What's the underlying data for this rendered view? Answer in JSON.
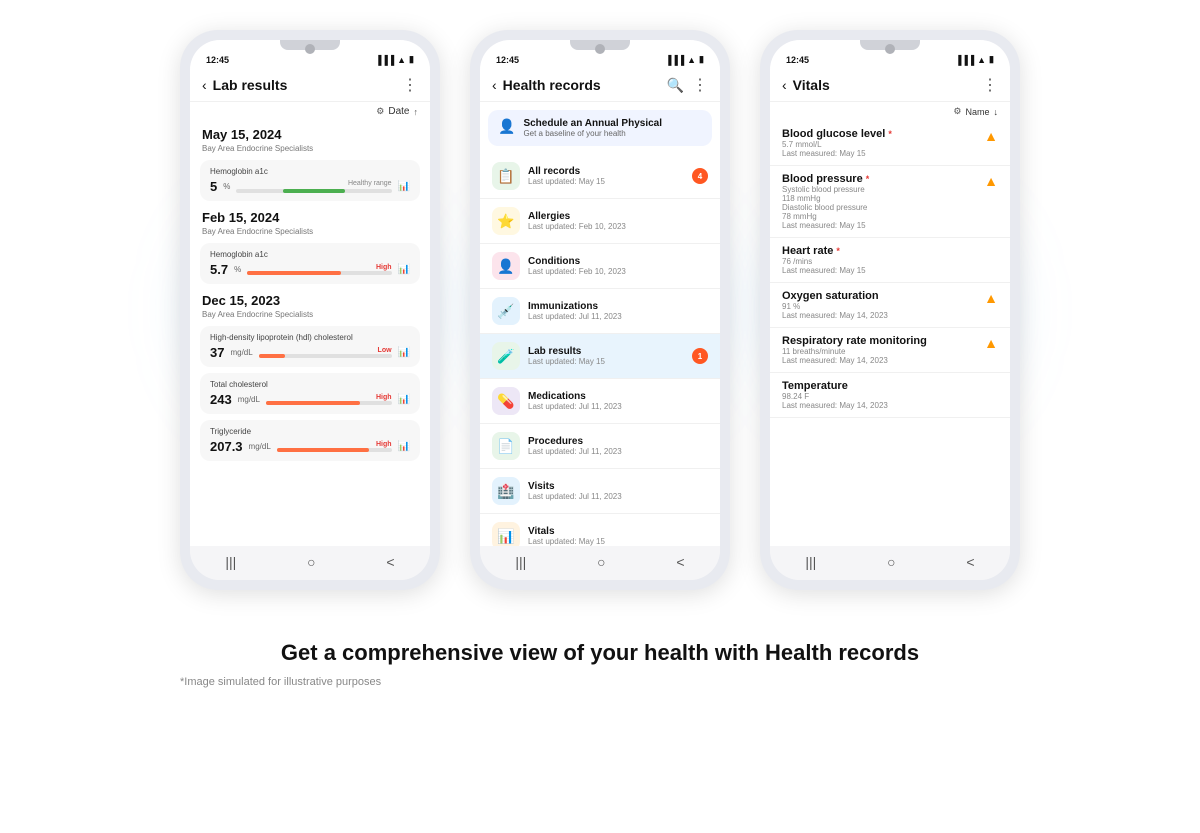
{
  "phone1": {
    "time": "12:45",
    "title": "Lab results",
    "sections": [
      {
        "date": "May 15, 2024",
        "facility": "Bay Area Endocrine Specialists",
        "items": [
          {
            "name": "Hemoglobin a1c",
            "value": "5",
            "unit": "%",
            "status": "Healthy range",
            "statusType": "good",
            "barPercent": 40
          }
        ]
      },
      {
        "date": "Feb 15, 2024",
        "facility": "Bay Area Endocrine Specialists",
        "items": [
          {
            "name": "Hemoglobin a1c",
            "value": "5.7",
            "unit": "%",
            "status": "High",
            "statusType": "high",
            "barPercent": 65
          }
        ]
      },
      {
        "date": "Dec 15, 2023",
        "facility": "Bay Area Endocrine Specialists",
        "items": [
          {
            "name": "High-density lipoprotein (hdl) cholesterol",
            "value": "37",
            "unit": "mg/dL",
            "status": "Low",
            "statusType": "low",
            "barPercent": 20
          },
          {
            "name": "Total cholesterol",
            "value": "243",
            "unit": "mg/dL",
            "status": "High",
            "statusType": "high",
            "barPercent": 75
          },
          {
            "name": "Triglyceride",
            "value": "207.3",
            "unit": "mg/dL",
            "status": "High",
            "statusType": "high",
            "barPercent": 80
          }
        ]
      }
    ],
    "filterLabel": "Date",
    "navIcons": [
      "|||",
      "○",
      "<"
    ]
  },
  "phone2": {
    "time": "12:45",
    "title": "Health records",
    "banner": {
      "icon": "👤",
      "title": "Schedule an Annual Physical",
      "subtitle": "Get a baseline of your health"
    },
    "items": [
      {
        "icon": "📋",
        "iconBg": "#e8f5e9",
        "name": "All records",
        "date": "Last updated: May 15",
        "badge": "4",
        "badgeColor": "badge-orange",
        "active": true
      },
      {
        "icon": "⭐",
        "iconBg": "#fff8e1",
        "name": "Allergies",
        "date": "Last updated: Feb 10, 2023",
        "badge": "",
        "badgeColor": ""
      },
      {
        "icon": "👤",
        "iconBg": "#fce4ec",
        "name": "Conditions",
        "date": "Last updated: Feb 10, 2023",
        "badge": "",
        "badgeColor": ""
      },
      {
        "icon": "💉",
        "iconBg": "#e3f2fd",
        "name": "Immunizations",
        "date": "Last updated: Jul 11, 2023",
        "badge": "",
        "badgeColor": ""
      },
      {
        "icon": "🧪",
        "iconBg": "#e8f5e9",
        "name": "Lab results",
        "date": "Last updated: May 15",
        "badge": "1",
        "badgeColor": "badge-orange",
        "active": true
      },
      {
        "icon": "💊",
        "iconBg": "#ede7f6",
        "name": "Medications",
        "date": "Last updated: Jul 11, 2023",
        "badge": "",
        "badgeColor": ""
      },
      {
        "icon": "📄",
        "iconBg": "#e8f5e9",
        "name": "Procedures",
        "date": "Last updated: Jul 11, 2023",
        "badge": "",
        "badgeColor": ""
      },
      {
        "icon": "🏥",
        "iconBg": "#e3f2fd",
        "name": "Visits",
        "date": "Last updated: Jul 11, 2023",
        "badge": "",
        "badgeColor": ""
      },
      {
        "icon": "📊",
        "iconBg": "#fff3e0",
        "name": "Vitals",
        "date": "Last updated: May 15",
        "badge": "",
        "badgeColor": "badge-teal",
        "active": true
      }
    ],
    "navIcons": [
      "|||",
      "○",
      "<"
    ]
  },
  "phone3": {
    "time": "12:45",
    "title": "Vitals",
    "filterLabel": "Name",
    "vitals": [
      {
        "name": "Blood glucose level",
        "asterisk": true,
        "sub1": "5.7 mmol/L",
        "sub2": "Last measured: May 15",
        "alert": true
      },
      {
        "name": "Blood pressure",
        "asterisk": true,
        "sub1": "Systolic blood pressure",
        "sub2": "118 mmHg",
        "sub3": "Diastolic blood pressure",
        "sub4": "78 mmHg",
        "sub5": "Last measured: May 15",
        "alert": true
      },
      {
        "name": "Heart rate",
        "asterisk": true,
        "sub1": "76 /mins",
        "sub2": "Last measured: May 15",
        "alert": false
      },
      {
        "name": "Oxygen saturation",
        "asterisk": false,
        "sub1": "91 %",
        "sub2": "Last measured: May 14, 2023",
        "alert": true
      },
      {
        "name": "Respiratory rate monitoring",
        "asterisk": false,
        "sub1": "11 breaths/minute",
        "sub2": "Last measured: May 14, 2023",
        "alert": true
      },
      {
        "name": "Temperature",
        "asterisk": false,
        "sub1": "98.24 F",
        "sub2": "Last measured: May 14, 2023",
        "alert": false
      }
    ],
    "navIcons": [
      "|||",
      "○",
      "<"
    ]
  },
  "headline": "Get a comprehensive view of your health with Health records",
  "disclaimer": "*Image simulated for illustrative purposes"
}
